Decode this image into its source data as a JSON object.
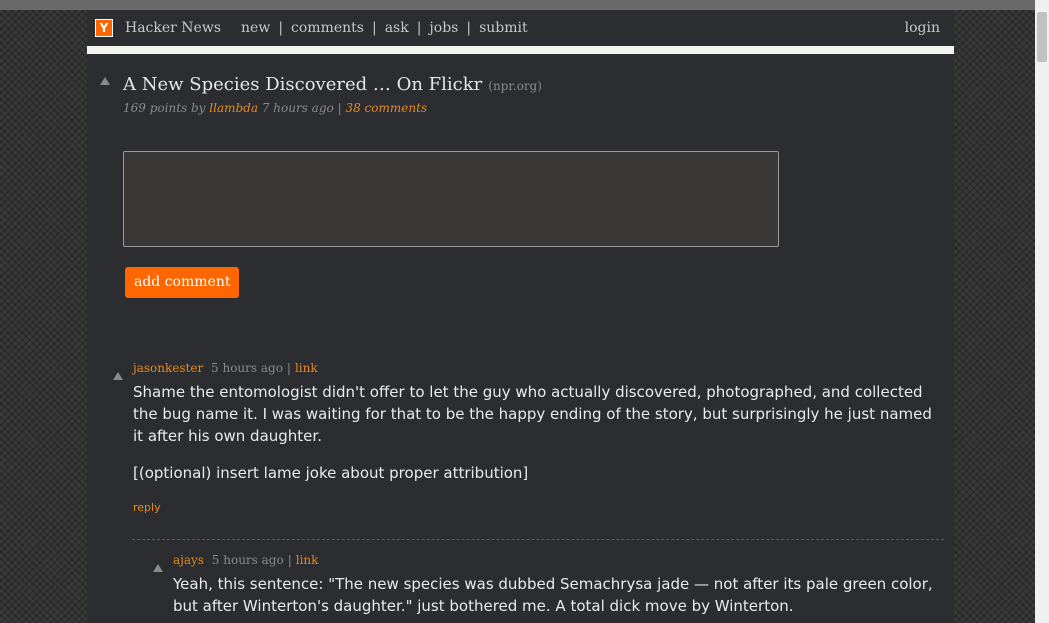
{
  "header": {
    "logo": "Y",
    "site_name": "Hacker News",
    "nav": [
      "new",
      "comments",
      "ask",
      "jobs",
      "submit"
    ],
    "login": "login"
  },
  "story": {
    "title": "A New Species Discovered … On Flickr",
    "domain": "(npr.org)",
    "points": "169 points by",
    "user": "llambda",
    "age": "7 hours ago",
    "comments": "38 comments"
  },
  "form": {
    "add_comment": "add comment"
  },
  "comments": [
    {
      "user": "jasonkester",
      "age": "5 hours ago",
      "link": "link",
      "paragraphs": [
        "Shame the entomologist didn't offer to let the guy who actually discovered, photographed, and collected the bug name it. I was waiting for that to be the happy ending of the story, but surprisingly he just named it after his own daughter.",
        "[(optional) insert lame joke about proper attribution]"
      ],
      "reply": "reply"
    },
    {
      "user": "ajays",
      "age": "5 hours ago",
      "link": "link",
      "paragraphs": [
        "Yeah, this sentence: \"The new species was dubbed Semachrysa jade — not after its pale green color, but after Winterton's daughter.\" just bothered me. A total dick move by Winterton."
      ]
    }
  ],
  "icons": {
    "vote": "upvote-arrow-icon",
    "logo": "y-logo-icon"
  },
  "colors": {
    "accent": "#ff6600",
    "link": "#e8891f",
    "background": "#2b2d31"
  }
}
